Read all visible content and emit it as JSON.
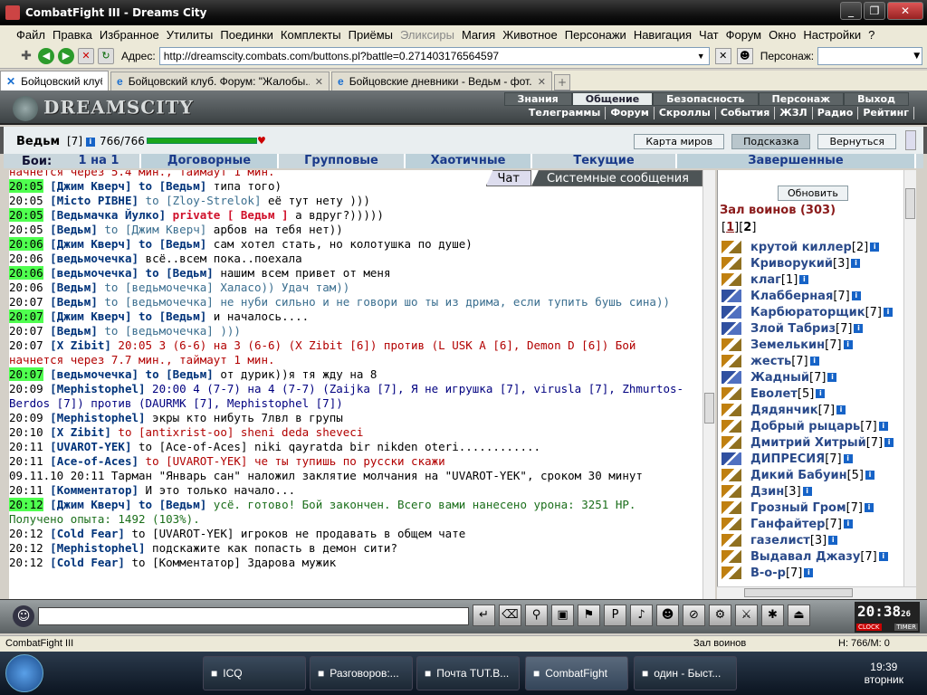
{
  "window": {
    "title": "CombatFight III - Dreams City"
  },
  "menubar": [
    "Файл",
    "Правка",
    "Избранное",
    "Утилиты",
    "Поединки",
    "Комплекты",
    "Приёмы",
    "Эликсиры",
    "Магия",
    "Животное",
    "Персонажи",
    "Навигация",
    "Чат",
    "Форум",
    "Окно",
    "Настройки",
    "?"
  ],
  "address": {
    "label": "Адрес:",
    "url": "http://dreamscity.combats.com/buttons.pl?battle=0.271403176564597",
    "person_label": "Персонаж:"
  },
  "tabs": [
    {
      "label": "Бойцовский клуб"
    },
    {
      "label": "Бойцовский клуб. Форум: \"Жалобы..."
    },
    {
      "label": "Бойцовские дневники - Ведьм - фот..."
    }
  ],
  "game": {
    "logo": "DREAMSCITY",
    "topnav": [
      "Знания",
      "Общение",
      "Безопасность",
      "Персонаж",
      "Выход"
    ],
    "topnav_active": "Общение",
    "subnav": [
      "Телеграммы",
      "Форум",
      "Скроллы",
      "События",
      "ЖЗЛ",
      "Радио",
      "Рейтинг"
    ]
  },
  "player": {
    "name": "Ведьм",
    "level": "[7]",
    "hp": "766/766",
    "hp_fraction": 1.0,
    "buttons": [
      "Карта миров",
      "Подсказка",
      "Вернуться"
    ]
  },
  "fights": {
    "label": "Бои:",
    "tabs": [
      "1 на 1",
      "Договорные",
      "Групповые",
      "Хаотичные",
      "Текущие",
      "Завершенные"
    ]
  },
  "chat": {
    "tabs": [
      "Чат",
      "Системные сообщения"
    ],
    "partial_top": "начнется через 5.4 мин., таймаут 1 мин.",
    "lines": [
      {
        "ts": "20:05",
        "hl": true,
        "parts": [
          [
            "nick",
            "[Джим Кверч]"
          ],
          [
            "tome",
            " to [Ведьм]"
          ],
          [
            "txt",
            " типа того)"
          ]
        ]
      },
      {
        "ts": "20:05",
        "hl": false,
        "parts": [
          [
            "nick",
            "[Micto PIBHE]"
          ],
          [
            "to",
            " to [Zloy-Strelok]"
          ],
          [
            "txt",
            " её тут нету )))"
          ]
        ]
      },
      {
        "ts": "20:05",
        "hl": true,
        "parts": [
          [
            "nick",
            "[Ведьмачка Йулко]"
          ],
          [
            "private",
            " private [ Ведьм ]"
          ],
          [
            "txt",
            " а вдруг?)))))"
          ]
        ]
      },
      {
        "ts": "",
        "hl": false,
        "parts": [
          [
            "txt",
            " "
          ]
        ]
      },
      {
        "ts": "20:05",
        "hl": false,
        "parts": [
          [
            "nick",
            "[Ведьм]"
          ],
          [
            "to",
            " to [Джим Кверч]"
          ],
          [
            "txt",
            "    арбов на тебя нет))"
          ]
        ]
      },
      {
        "ts": "20:06",
        "hl": true,
        "parts": [
          [
            "nick",
            "[Джим Кверч]"
          ],
          [
            "tome",
            " to [Ведьм]"
          ],
          [
            "txt",
            " сам хотел стать, но колотушка по душе)"
          ]
        ]
      },
      {
        "ts": "20:06",
        "hl": false,
        "parts": [
          [
            "nick",
            "[ведьмочечка]"
          ],
          [
            "txt",
            " всё..всем пока..поехала"
          ]
        ]
      },
      {
        "ts": "20:06",
        "hl": true,
        "parts": [
          [
            "nick",
            "[ведьмочечка]"
          ],
          [
            "tome",
            " to [Ведьм]"
          ],
          [
            "txt",
            " нашим всем привет от меня"
          ]
        ]
      },
      {
        "ts": "20:06",
        "hl": false,
        "parts": [
          [
            "nick",
            "[Ведьм]"
          ],
          [
            "to",
            " to [ведьмочечка] Халасо)) Удач там))"
          ]
        ]
      },
      {
        "ts": "20:07",
        "hl": false,
        "parts": [
          [
            "nick",
            "[Ведьм]"
          ],
          [
            "to",
            " to [ведьмочечка] не нуби сильно и не говори шо ты из дрима, если тупить бушь сина))"
          ]
        ]
      },
      {
        "ts": "20:07",
        "hl": true,
        "parts": [
          [
            "nick",
            "[Джим Кверч]"
          ],
          [
            "tome",
            " to [Ведьм]"
          ],
          [
            "txt",
            " и началось...."
          ]
        ]
      },
      {
        "ts": "20:07",
        "hl": false,
        "parts": [
          [
            "nick",
            "[Ведьм]"
          ],
          [
            "to",
            " to [ведьмочечка] )))"
          ]
        ]
      },
      {
        "ts": "20:07",
        "hl": false,
        "parts": [
          [
            "nick",
            "[X Zibit]"
          ],
          [
            "red",
            " 20:05 3 (6-6) на 3 (6-6) (X Zibit [6]) против (L USK A [6], Demon D [6]) Бой начнется через 7.7 мин., таймаут 1 мин."
          ]
        ]
      },
      {
        "ts": "20:07",
        "hl": true,
        "parts": [
          [
            "nick",
            "[ведьмочечка]"
          ],
          [
            "tome",
            " to [Ведьм]"
          ],
          [
            "txt",
            " от дурик))я тя жду на 8"
          ]
        ]
      },
      {
        "ts": "20:09",
        "hl": false,
        "parts": [
          [
            "nick",
            "[Mephistophel]"
          ],
          [
            "tr",
            " 20:00 4 (7-7) на 4 (7-7) (Zaijka [7], Я не игрушка [7], virusla [7], Zhmurtos-Berdos [7]) против (DAURMK [7], Mephistophel [7])"
          ]
        ]
      },
      {
        "ts": "20:09",
        "hl": false,
        "parts": [
          [
            "nick",
            "[Mephistophel]"
          ],
          [
            "txt",
            " экры кто нибуть 7лвл в групы"
          ]
        ]
      },
      {
        "ts": "20:10",
        "hl": false,
        "parts": [
          [
            "nick",
            "[X Zibit]"
          ],
          [
            "red",
            " to [antixrist-oo] sheni deda sheveci"
          ]
        ]
      },
      {
        "ts": "20:11",
        "hl": false,
        "parts": [
          [
            "nick",
            "[UVAROT-YEK]"
          ],
          [
            "txt",
            " to [Ace-of-Aces] niki qayratda bir nikden oteri............"
          ]
        ]
      },
      {
        "ts": "20:11",
        "hl": false,
        "parts": [
          [
            "nick",
            "[Ace-of-Aces]"
          ],
          [
            "red",
            " to [UVAROT-YEK] че ты тупишь по русски скажи"
          ]
        ]
      },
      {
        "ts": "",
        "hl": false,
        "parts": [
          [
            "txt",
            " "
          ]
        ]
      },
      {
        "ts": "09.11.10 20:11",
        "hl": false,
        "parts": [
          [
            "txt",
            "     Тарман \"Январь сан\" наложил заклятие молчания на \"UVAROT-YEK\", сроком 30 минут"
          ]
        ]
      },
      {
        "ts": "20:11",
        "hl": false,
        "parts": [
          [
            "nick",
            "[Комментатор]"
          ],
          [
            "txt",
            " И это только начало..."
          ]
        ]
      },
      {
        "ts": "20:12",
        "hl": true,
        "parts": [
          [
            "nick",
            "[Джим Кверч]"
          ],
          [
            "tome",
            " to [Ведьм]"
          ],
          [
            "grn",
            " усё. готово! Бой закончен. Всего вами нанесено урона: 3251 HP. Получено опыта: 1492 (103%)."
          ]
        ]
      },
      {
        "ts": "20:12",
        "hl": false,
        "parts": [
          [
            "nick",
            "[Cold Fear]"
          ],
          [
            "txt",
            " to [UVAROT-YEK] игроков не продавать в общем чате"
          ]
        ]
      },
      {
        "ts": "20:12",
        "hl": false,
        "parts": [
          [
            "nick",
            "[Mephistophel]"
          ],
          [
            "txt",
            " подскажите как попасть в демон сити?"
          ]
        ]
      },
      {
        "ts": "20:12",
        "hl": false,
        "parts": [
          [
            "nick",
            "[Cold Fear]"
          ],
          [
            "txt",
            " to [Комментатор] Здарова мужик"
          ]
        ]
      }
    ]
  },
  "hall": {
    "refresh": "Обновить",
    "title": "Зал воинов (303)",
    "pages": [
      "1",
      "2"
    ],
    "users": [
      {
        "name": "крутой киллер",
        "level": "[2]",
        "icon": "fight"
      },
      {
        "name": "Криворукий",
        "level": "[3]",
        "icon": "fight"
      },
      {
        "name": "клаг",
        "level": "[1]",
        "icon": "fight"
      },
      {
        "name": "Клабберная",
        "level": "[7]",
        "icon": "plain"
      },
      {
        "name": "Карбюраторщик",
        "level": "[7]",
        "icon": "plain"
      },
      {
        "name": "Злой Табриз",
        "level": "[7]",
        "icon": "plain"
      },
      {
        "name": "Земелькин",
        "level": "[7]",
        "icon": "fight"
      },
      {
        "name": "жесть",
        "level": "[7]",
        "icon": "fight"
      },
      {
        "name": "Жадный",
        "level": "[7]",
        "icon": "plain"
      },
      {
        "name": "Еволет",
        "level": "[5]",
        "icon": "fight"
      },
      {
        "name": "Дядянчик",
        "level": "[7]",
        "icon": "fight"
      },
      {
        "name": "Добрый рыцарь",
        "level": "[7]",
        "icon": "fight"
      },
      {
        "name": "Дмитрий Хитрый",
        "level": "[7]",
        "icon": "fight"
      },
      {
        "name": "ДИПРЕСИЯ",
        "level": "[7]",
        "icon": "plain"
      },
      {
        "name": "Дикий Бабуин",
        "level": "[5]",
        "icon": "fight"
      },
      {
        "name": "Дзин",
        "level": "[3]",
        "icon": "fight"
      },
      {
        "name": "Грозный Гром",
        "level": "[7]",
        "icon": "fight"
      },
      {
        "name": "Ганфайтер",
        "level": "[7]",
        "icon": "fight"
      },
      {
        "name": "газелист",
        "level": "[3]",
        "icon": "fight"
      },
      {
        "name": "Выдавал Джазу",
        "level": "[7]",
        "icon": "fight"
      },
      {
        "name": "В-о-р",
        "level": "[7]",
        "icon": "fight"
      }
    ]
  },
  "clock": {
    "time": "20:38",
    "sec": "26",
    "clock_label": "CLOCK",
    "timer_label": "TIMER"
  },
  "statusbar": {
    "left": "CombatFight III",
    "mid": "Зал воинов",
    "right": "H: 766/M: 0"
  },
  "taskbar": {
    "tasks": [
      "ICQ",
      "Разговоров:...",
      "Почта TUT.B...",
      "CombatFight",
      "один - Быст..."
    ],
    "active": "CombatFight",
    "time": "19:39",
    "day": "вторник"
  }
}
